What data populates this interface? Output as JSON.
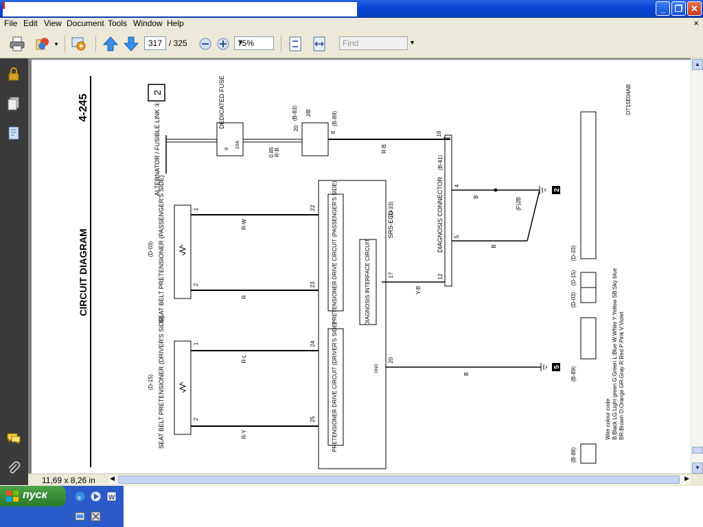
{
  "window": {
    "close_doc_glyph": "×"
  },
  "menu": [
    "File",
    "Edit",
    "View",
    "Document",
    "Tools",
    "Window",
    "Help"
  ],
  "toolbar": {
    "page_current": "317",
    "page_total": "/  325",
    "zoom": "75%",
    "find_placeholder": "Find"
  },
  "status": {
    "page_size": "11,69 x 8,26 in"
  },
  "taskbar": {
    "start_label": "пуск"
  },
  "diagram": {
    "page_number": "4-245",
    "title": "CIRCUIT DIAGRAM",
    "page_box": "2",
    "code": "DT15E04AB",
    "alternator": "ALTERNATOR / FUSIBLE LINK ①",
    "fuse_label": "DEDICATED FUSE",
    "fuse_num": "③",
    "fuse_rating": "10A",
    "wire_top_size": "0.85",
    "wire_top_color": "R-B",
    "jb_label": "J/B",
    "jb_ref1": "(B-83)",
    "jb_ref2": "(B-89)",
    "jb_pin_in": "20",
    "jb_pin_out": "8",
    "wire_rb": "R-B",
    "diag_connector": "DIAGNOSIS CONNECTOR",
    "diag_ref": "(B-41)",
    "diag_pin16": "16",
    "diag_pin4": "4",
    "diag_pin5": "5",
    "diag_pin12": "12",
    "wire_b1": "B",
    "wire_b2": "B",
    "wire_p2b": "(F)2B",
    "ground_2": "2",
    "srs_ecu": "SRS-ECU",
    "srs_ref": "(D-33)",
    "diag_interface": "DIAGNOSIS INTERFACE CIRCUIT",
    "pin17": "17",
    "wire_yb": "Y-B",
    "pin20": "20",
    "gnd": "GND",
    "wire_gnd_b": "B",
    "ground_5": "5",
    "pass_pret_ref": "(D-03)",
    "pass_pret": "SEAT BELT PRETENSIONER (PASSENGER'S SIDE)",
    "pass_circuit": "PRETENSIONER DRIVE CIRCUIT (PASSENGER'S SIDE)",
    "pass_pin1": "1",
    "pass_pin2": "2",
    "pin22": "22",
    "pin23": "23",
    "wire_rw": "R-W",
    "wire_r": "R",
    "drv_pret_ref": "(D-15)",
    "drv_pret": "SEAT BELT PRETENSIONER (DRIVER'S SIDE)",
    "drv_circuit": "PRETENSIONER DRIVE CIRCUIT (DRIVER'S SIDE)",
    "drv_pin1": "1",
    "drv_pin2": "2",
    "pin24": "24",
    "pin25": "25",
    "wire_rl": "R-L",
    "wire_ry": "R-Y",
    "conn_refs": [
      "(B-88)",
      "(B-89)",
      "(D-03)",
      "(D-15)",
      "(D-33)"
    ],
    "legend_title": "Wire colour code",
    "legend": [
      "B:Black  LG:Light green  G:Green  L:Blue  W:White  Y:Yellow  SB:Sky blue",
      "BR:Brown  O:Orange  GR:Gray  R:Red  P:Pink  V:Violet"
    ]
  }
}
